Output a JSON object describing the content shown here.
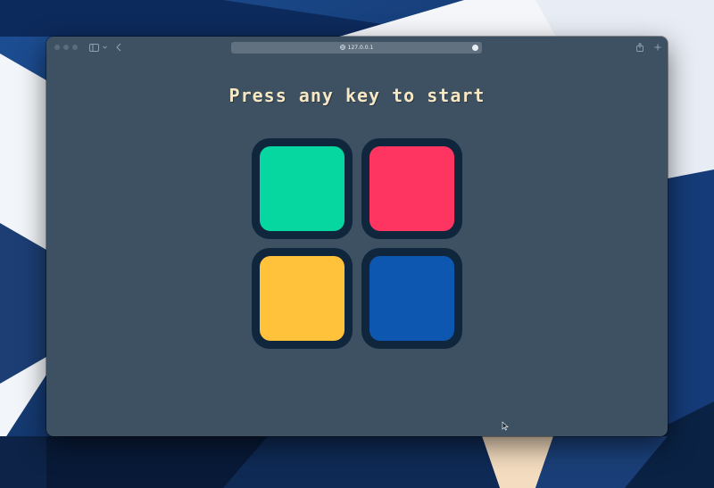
{
  "browser": {
    "address": "127.0.0.1"
  },
  "game": {
    "prompt": "Press any key to start",
    "pads": [
      {
        "id": "green",
        "color": "#06d6a0"
      },
      {
        "id": "red",
        "color": "#ff3561"
      },
      {
        "id": "yellow",
        "color": "#ffc23a"
      },
      {
        "id": "blue",
        "color": "#0e57b0"
      }
    ]
  },
  "colors": {
    "page_background": "#3e5163",
    "pad_border": "#0f263c",
    "title_text": "#f6e8c3"
  }
}
